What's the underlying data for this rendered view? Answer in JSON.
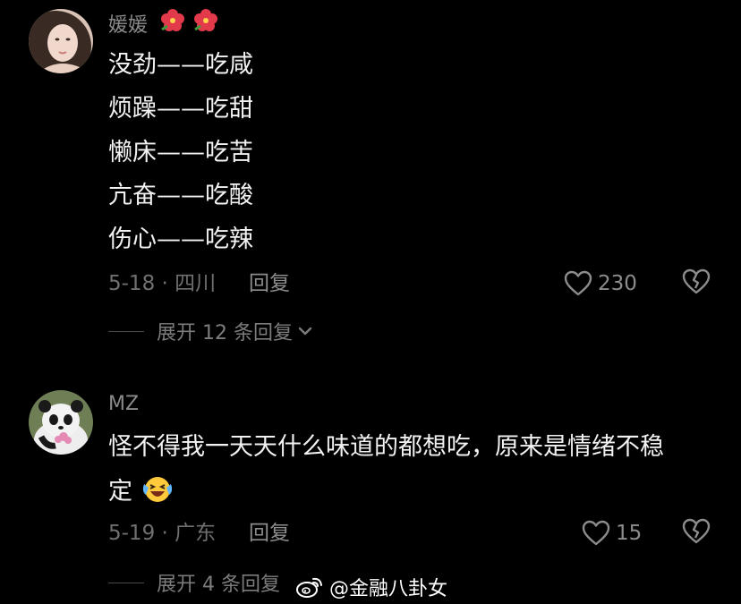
{
  "comments": [
    {
      "username": "媛媛",
      "lines": [
        "没劲——吃咸",
        "烦躁——吃甜",
        "懒床——吃苦",
        "亢奋——吃酸",
        "伤心——吃辣"
      ],
      "date_location": "5-18 · 四川",
      "reply_label": "回复",
      "likes": "230",
      "expand_label": "展开 12 条回复"
    },
    {
      "username": "MZ",
      "lines": [
        "怪不得我一天天什么味道的都想吃，原来是情绪不稳",
        "定"
      ],
      "emoji": "laughing-crying",
      "date_location": "5-19 · 广东",
      "reply_label": "回复",
      "likes": "15",
      "expand_label": "展开 4 条回复"
    }
  ],
  "watermark": {
    "text": "@金融八卦女",
    "icon": "weibo-icon"
  },
  "colors": {
    "background": "#000000",
    "text": "#f2f2f2",
    "muted": "#8c8c8c",
    "flower": "#e23a4a"
  }
}
